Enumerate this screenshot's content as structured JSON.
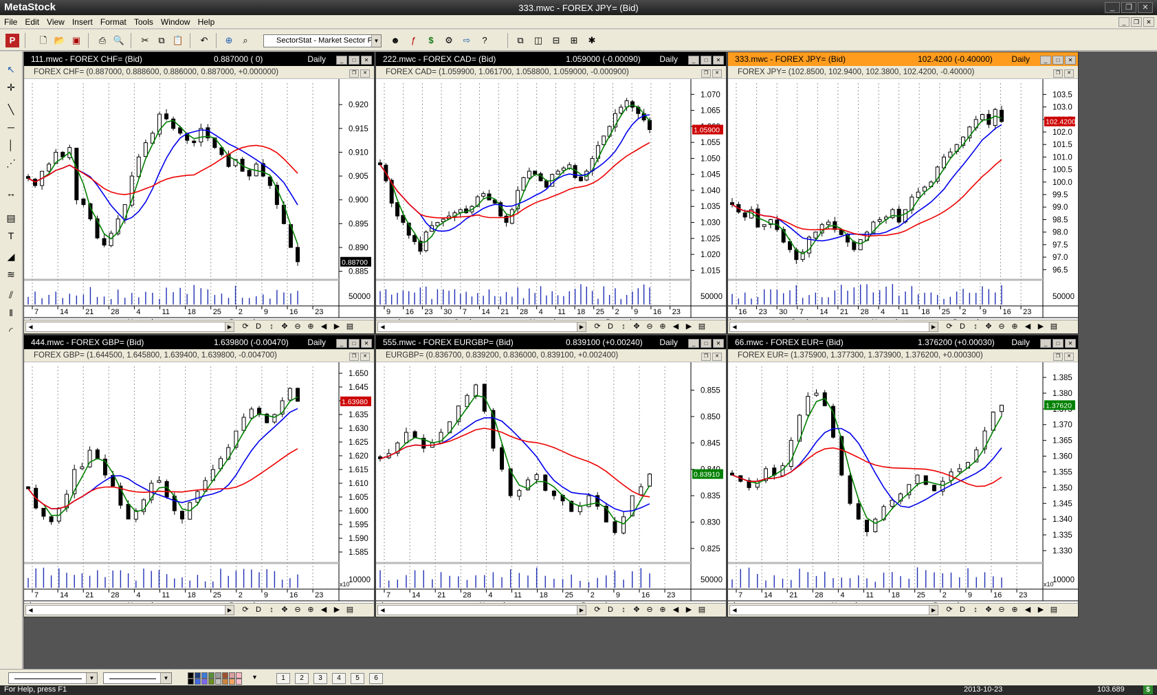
{
  "app": {
    "name": "MetaStock",
    "window_title": "333.mwc - FOREX JPY= (Bid)"
  },
  "window_buttons": {
    "minimize": "_",
    "restore": "❐",
    "close": "✕"
  },
  "menu": [
    "File",
    "Edit",
    "View",
    "Insert",
    "Format",
    "Tools",
    "Window",
    "Help"
  ],
  "toolbar": {
    "sector_dropdown": "SectorStat - Market Sector F",
    "icons": [
      "metastock-logo-icon",
      "new-icon",
      "open-icon",
      "close-chart-icon",
      "print-icon",
      "print-preview-icon",
      "cut-icon",
      "copy-icon",
      "paste-icon",
      "undo-icon",
      "crosshair-icon",
      "zoom-icon",
      "sector-icon",
      "dropdown-arrow-icon",
      "expert-advisor-icon",
      "formula-icon",
      "dollar-icon",
      "explorer-icon",
      "system-tester-icon",
      "question-icon",
      "cascade-icon",
      "tile-vertical-icon",
      "tile-horizontal-icon",
      "tile-grid-icon",
      "settings-icon"
    ]
  },
  "left_toolbar_icons": [
    "pointer-icon",
    "crosshair-tool-icon",
    "trendline-icon",
    "horizontal-line-icon",
    "vertical-line-icon",
    "fibonacci-icon",
    "arrow-left-right-icon",
    "zoom-tool-icon",
    "text-tool-icon",
    "regression-icon",
    "speed-resistance-icon",
    "parallel-lines-icon",
    "cycle-lines-icon",
    "arc-tool-icon"
  ],
  "charts": [
    {
      "id": "111",
      "title": "111.mwc - FOREX CHF= (Bid)",
      "price": "0.887000 ( 0)",
      "period": "Daily",
      "active": false,
      "header": "FOREX CHF= (0.887000, 0.888600, 0.886000, 0.887000, +0.000000)",
      "y_ticks": [
        "0.920",
        "0.915",
        "0.910",
        "0.905",
        "0.900",
        "0.895",
        "0.890",
        "0.885"
      ],
      "y_range": [
        0.8835,
        0.9245
      ],
      "last_label": "0.88700",
      "last_value": 0.887,
      "last_color": "#000000",
      "vol_label": "50000",
      "x_ticks": [
        "7",
        "14",
        "21",
        "28",
        "4",
        "11",
        "18",
        "25",
        "2",
        "9",
        "16",
        "23"
      ],
      "months": [
        "ober",
        "November",
        "December"
      ],
      "month_at": [
        0,
        4,
        8
      ]
    },
    {
      "id": "222",
      "title": "222.mwc - FOREX CAD= (Bid)",
      "price": "1.059000 (-0.00090)",
      "period": "Daily",
      "active": false,
      "header": "FOREX CAD= (1.059900, 1.061700, 1.058800, 1.059000, -0.000900)",
      "y_ticks": [
        "1.070",
        "1.065",
        "1.060",
        "1.055",
        "1.050",
        "1.045",
        "1.040",
        "1.035",
        "1.030",
        "1.025",
        "1.020",
        "1.015"
      ],
      "y_range": [
        1.0125,
        1.0735
      ],
      "last_label": "1.05900",
      "last_value": 1.059,
      "last_color": "#cc0000",
      "vol_label": "50000",
      "x_ticks": [
        "9",
        "16",
        "23",
        "30",
        "7",
        "14",
        "21",
        "28",
        "4",
        "11",
        "18",
        "25",
        "2",
        "9",
        "16",
        "23"
      ],
      "months": [
        "eptember",
        "October",
        "November",
        "December"
      ],
      "month_at": [
        0,
        4,
        8,
        12
      ]
    },
    {
      "id": "333",
      "title": "333.mwc - FOREX JPY= (Bid)",
      "price": "102.4200 (-0.40000)",
      "period": "Daily",
      "active": true,
      "header": "FOREX JPY= (102.8500, 102.9400, 102.3800, 102.4200, -0.40000)",
      "y_ticks": [
        "103.5",
        "103.0",
        "102.5",
        "102.0",
        "101.5",
        "101.0",
        "100.5",
        "100.0",
        "99.5",
        "99.0",
        "98.5",
        "98.0",
        "97.5",
        "97.0",
        "96.5"
      ],
      "y_range": [
        96.15,
        103.95
      ],
      "last_label": "102.4200",
      "last_value": 102.42,
      "last_color": "#cc0000",
      "vol_label": "50000",
      "x_ticks": [
        "16",
        "23",
        "30",
        "7",
        "14",
        "21",
        "28",
        "4",
        "11",
        "18",
        "25",
        "2",
        "9",
        "16",
        "23"
      ],
      "months": [
        "ber",
        "October",
        "November",
        "December"
      ],
      "month_at": [
        0,
        3,
        7,
        11
      ]
    },
    {
      "id": "444",
      "title": "444.mwc - FOREX GBP= (Bid)",
      "price": "1.639800 (-0.00470)",
      "period": "Daily",
      "active": false,
      "header": "FOREX GBP= (1.644500, 1.645800, 1.639400, 1.639800, -0.004700)",
      "y_ticks": [
        "1.650",
        "1.645",
        "1.640",
        "1.635",
        "1.630",
        "1.625",
        "1.620",
        "1.615",
        "1.610",
        "1.605",
        "1.600",
        "1.595",
        "1.590",
        "1.585"
      ],
      "y_range": [
        1.5815,
        1.6525
      ],
      "last_label": "1.63980",
      "last_value": 1.6398,
      "last_color": "#cc0000",
      "vol_label": "10000",
      "vol_mult": "x10",
      "x_ticks": [
        "7",
        "14",
        "21",
        "28",
        "4",
        "11",
        "18",
        "25",
        "2",
        "9",
        "16",
        "23"
      ],
      "months": [
        "ober",
        "November",
        "December"
      ],
      "month_at": [
        0,
        4,
        8
      ]
    },
    {
      "id": "555",
      "title": "555.mwc - FOREX EURGBP= (Bid)",
      "price": "0.839100 (+0.00240)",
      "period": "Daily",
      "active": false,
      "header": "EURGBP= (0.836700, 0.839200, 0.836000, 0.839100, +0.002400)",
      "y_ticks": [
        "0.855",
        "0.850",
        "0.845",
        "0.840",
        "0.835",
        "0.830",
        "0.825"
      ],
      "y_range": [
        0.8225,
        0.8595
      ],
      "last_label": "0.83910",
      "last_value": 0.8391,
      "last_color": "#008000",
      "vol_label": "50000",
      "x_ticks": [
        "7",
        "14",
        "21",
        "28",
        "4",
        "11",
        "18",
        "25",
        "2",
        "9",
        "16",
        "23"
      ],
      "months": [
        "ober",
        "November",
        "December"
      ],
      "month_at": [
        0,
        4,
        8
      ]
    },
    {
      "id": "66",
      "title": "66.mwc - FOREX EUR= (Bid)",
      "price": "1.376200 (+0.00030)",
      "period": "Daily",
      "active": false,
      "header": "FOREX EUR= (1.375900, 1.377300, 1.373900, 1.376200, +0.000300)",
      "y_ticks": [
        "1.385",
        "1.380",
        "1.375",
        "1.370",
        "1.365",
        "1.360",
        "1.355",
        "1.350",
        "1.345",
        "1.340",
        "1.335",
        "1.330"
      ],
      "y_range": [
        1.3265,
        1.3885
      ],
      "last_label": "1.37620",
      "last_value": 1.3762,
      "last_color": "#008000",
      "vol_label": "10000",
      "vol_mult": "x10",
      "x_ticks": [
        "7",
        "14",
        "21",
        "28",
        "4",
        "11",
        "18",
        "25",
        "2",
        "9",
        "16",
        "23"
      ],
      "months": [
        "ober",
        "November",
        "December"
      ],
      "month_at": [
        0,
        4,
        8
      ]
    }
  ],
  "chart_data": [
    {
      "type": "line",
      "title": "FOREX CHF=",
      "series": [],
      "note_values": {
        "open": 0.887,
        "high": 0.8886,
        "low": 0.886,
        "close": 0.887
      },
      "x": [],
      "ylim": [
        0.8835,
        0.9245
      ]
    },
    {
      "type": "line",
      "title": "FOREX CAD=",
      "series": [],
      "ylim": [
        1.0125,
        1.0735
      ]
    },
    {
      "type": "line",
      "title": "FOREX JPY=",
      "series": [],
      "ylim": [
        96.15,
        103.95
      ]
    },
    {
      "type": "line",
      "title": "FOREX GBP=",
      "series": [],
      "ylim": [
        1.5815,
        1.6525
      ]
    },
    {
      "type": "line",
      "title": "EURGBP=",
      "series": [],
      "ylim": [
        0.8225,
        0.8595
      ]
    },
    {
      "type": "line",
      "title": "FOREX EUR=",
      "series": [],
      "ylim": [
        1.3265,
        1.3885
      ]
    }
  ],
  "closes": {
    "111": [
      0.9045,
      0.903,
      0.906,
      0.9075,
      0.91,
      0.909,
      0.911,
      0.9,
      0.899,
      0.896,
      0.892,
      0.8905,
      0.893,
      0.896,
      0.899,
      0.905,
      0.909,
      0.912,
      0.914,
      0.918,
      0.917,
      0.915,
      0.914,
      0.9125,
      0.912,
      0.915,
      0.913,
      0.911,
      0.9095,
      0.907,
      0.9085,
      0.906,
      0.905,
      0.9075,
      0.905,
      0.903,
      0.899,
      0.895,
      0.89,
      0.887
    ],
    "222": [
      1.048,
      1.043,
      1.036,
      1.032,
      1.03,
      1.026,
      1.024,
      1.021,
      1.027,
      1.029,
      1.03,
      1.031,
      1.032,
      1.033,
      1.034,
      1.033,
      1.035,
      1.038,
      1.039,
      1.037,
      1.036,
      1.032,
      1.03,
      1.034,
      1.04,
      1.044,
      1.046,
      1.045,
      1.043,
      1.041,
      1.045,
      1.046,
      1.047,
      1.048,
      1.044,
      1.043,
      1.046,
      1.05,
      1.054,
      1.057,
      1.06,
      1.064,
      1.066,
      1.068,
      1.066,
      1.064,
      1.062,
      1.059
    ],
    "333": [
      99.1,
      98.8,
      98.6,
      98.9,
      98.2,
      98.3,
      98.5,
      98.1,
      97.6,
      97.3,
      96.9,
      97.2,
      97.8,
      98.0,
      98.3,
      98.4,
      98.1,
      97.9,
      97.6,
      97.3,
      97.7,
      98.0,
      98.4,
      98.5,
      98.6,
      98.9,
      98.4,
      98.9,
      99.4,
      99.6,
      99.8,
      100.0,
      100.6,
      101.0,
      101.2,
      101.5,
      101.8,
      102.2,
      102.5,
      102.7,
      102.3,
      102.9,
      102.42
    ],
    "444": [
      1.608,
      1.601,
      1.598,
      1.596,
      1.601,
      1.606,
      1.615,
      1.616,
      1.622,
      1.619,
      1.613,
      1.609,
      1.602,
      1.597,
      1.6,
      1.604,
      1.61,
      1.611,
      1.605,
      1.6,
      1.597,
      1.603,
      1.607,
      1.611,
      1.615,
      1.619,
      1.623,
      1.629,
      1.634,
      1.637,
      1.635,
      1.632,
      1.635,
      1.64,
      1.6445,
      1.6398
    ],
    "555": [
      0.842,
      0.843,
      0.845,
      0.847,
      0.846,
      0.844,
      0.845,
      0.847,
      0.849,
      0.852,
      0.854,
      0.856,
      0.851,
      0.844,
      0.84,
      0.835,
      0.836,
      0.838,
      0.839,
      0.836,
      0.835,
      0.834,
      0.832,
      0.833,
      0.835,
      0.833,
      0.83,
      0.828,
      0.831,
      0.835,
      0.8367,
      0.8391
    ],
    "66": [
      1.354,
      1.352,
      1.35,
      1.352,
      1.356,
      1.354,
      1.357,
      1.365,
      1.373,
      1.379,
      1.38,
      1.376,
      1.366,
      1.354,
      1.345,
      1.34,
      1.336,
      1.34,
      1.344,
      1.346,
      1.348,
      1.351,
      1.354,
      1.351,
      1.349,
      1.352,
      1.355,
      1.356,
      1.358,
      1.362,
      1.368,
      1.374,
      1.3762
    ]
  },
  "bottom": {
    "window_tabs": [
      "1",
      "2",
      "3",
      "4",
      "5",
      "6"
    ],
    "palette": [
      "#000000",
      "#1f3d7a",
      "#3b7dd8",
      "#5a8f3c",
      "#9c9c9c",
      "#a0522d",
      "#d8a0a0",
      "#ffb6c1",
      "#000000",
      "#4169e1",
      "#7b68ee",
      "#6b8e23",
      "#c0c0c0",
      "#cd853f",
      "#f4a460",
      "#ffc0cb"
    ]
  },
  "status": {
    "help": "For Help, press F1",
    "date": "2013-10-23",
    "value": "103.689",
    "dollar": "$"
  }
}
